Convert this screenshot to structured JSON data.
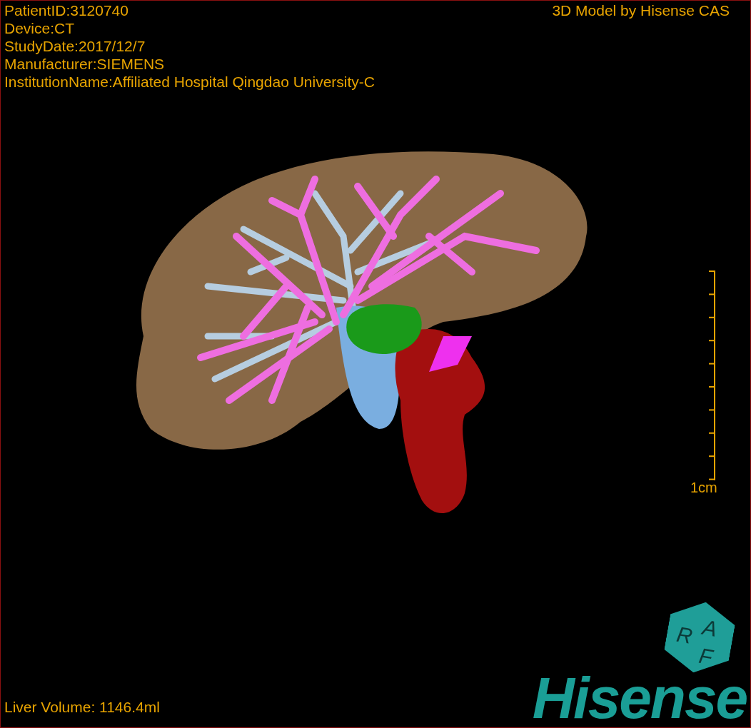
{
  "info_lines": [
    "PatientID:3120740",
    "Device:CT",
    "StudyDate:2017/12/7",
    "Manufacturer:SIEMENS",
    "InstitutionName:Affiliated Hospital Qingdao University-C"
  ],
  "credit": "3D Model by Hisense CAS",
  "scale_bar": {
    "label": "1cm"
  },
  "volume": "Liver Volume: 1146.4ml",
  "logo": {
    "badge_letters": [
      "R",
      "A",
      "F"
    ],
    "wordmark": "Hisense"
  }
}
